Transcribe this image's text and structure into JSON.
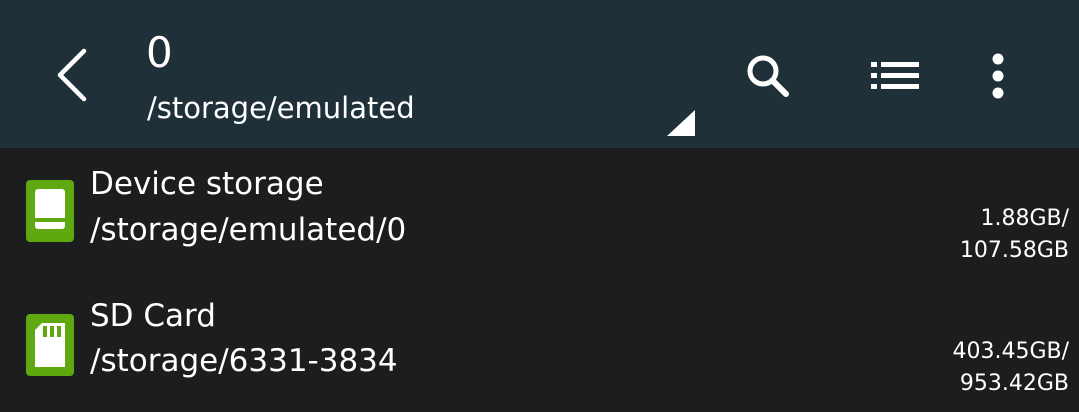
{
  "toolbar": {
    "title": "0",
    "path": "/storage/emulated",
    "icons": [
      "back-arrow-icon",
      "search-icon",
      "list-view-icon",
      "more-vert-icon"
    ]
  },
  "colors": {
    "toolbar_bg": "#203039",
    "list_bg": "#1b1d1f",
    "storage_icon": "#5fa80f",
    "text": "#ffffff"
  },
  "storage_list": [
    {
      "name": "Device storage",
      "path": "/storage/emulated/0",
      "used": "1.88GB/",
      "total": "107.58GB",
      "icon": "device-storage-icon"
    },
    {
      "name": "SD Card",
      "path": "/storage/6331-3834",
      "used": "403.45GB/",
      "total": "953.42GB",
      "icon": "sd-card-icon"
    }
  ]
}
